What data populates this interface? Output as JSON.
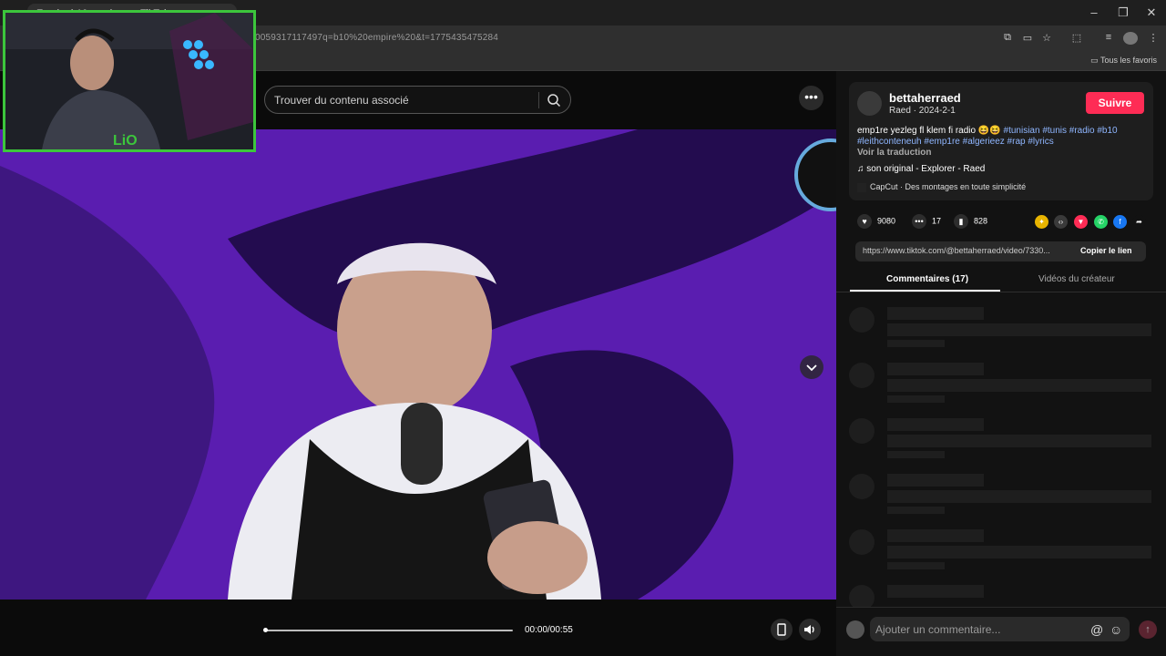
{
  "browser": {
    "tab_title": "Empire b10 empire sur TikTok",
    "url": "0059317117497q=b10%20empire%20&t=1775435475284",
    "bookmark_label": "Tous les favoris",
    "window_controls": [
      "–",
      "❐",
      "✕"
    ]
  },
  "search": {
    "placeholder": "Trouver du contenu associé"
  },
  "player": {
    "time": "00:00/00:55",
    "progress_fraction": 0.0
  },
  "post": {
    "username": "bettaherraed",
    "subline": "Raed · 2024-2-1",
    "follow_label": "Suivre",
    "caption_text": "emp1re yezleg fl klem fi radio 😆😆",
    "hashtags": "#tunisian #tunis #radio #b10 #leithconteneuh #emp1re #algerieez #rap #lyrics",
    "translate_label": "Voir la traduction",
    "music": "son original - Explorer - Raed",
    "capcut": "CapCut · Des montages en toute simplicité"
  },
  "stats": {
    "likes": "9080",
    "comments": "17",
    "saves": "828"
  },
  "share_icons": [
    {
      "name": "gold-coin-icon",
      "color": "#e8b400",
      "glyph": "✦"
    },
    {
      "name": "embed-icon",
      "color": "#3a3a3a",
      "glyph": "‹›"
    },
    {
      "name": "tiktok-share-icon",
      "color": "#fe2c55",
      "glyph": "▼"
    },
    {
      "name": "whatsapp-icon",
      "color": "#25d366",
      "glyph": "✆"
    },
    {
      "name": "facebook-icon",
      "color": "#1877f2",
      "glyph": "f"
    },
    {
      "name": "forward-icon",
      "color": "#121212",
      "glyph": "➦"
    }
  ],
  "link": {
    "url": "https://www.tiktok.com/@bettaherraed/video/7330...",
    "copy_label": "Copier le lien"
  },
  "tabs": {
    "comments": "Commentaires (17)",
    "creator_videos": "Vidéos du créateur"
  },
  "comment_bar": {
    "placeholder": "Ajouter un commentaire..."
  },
  "colors": {
    "accent": "#fe2c55",
    "video_bg": "#5a1db0",
    "panel_bg": "#121212"
  }
}
